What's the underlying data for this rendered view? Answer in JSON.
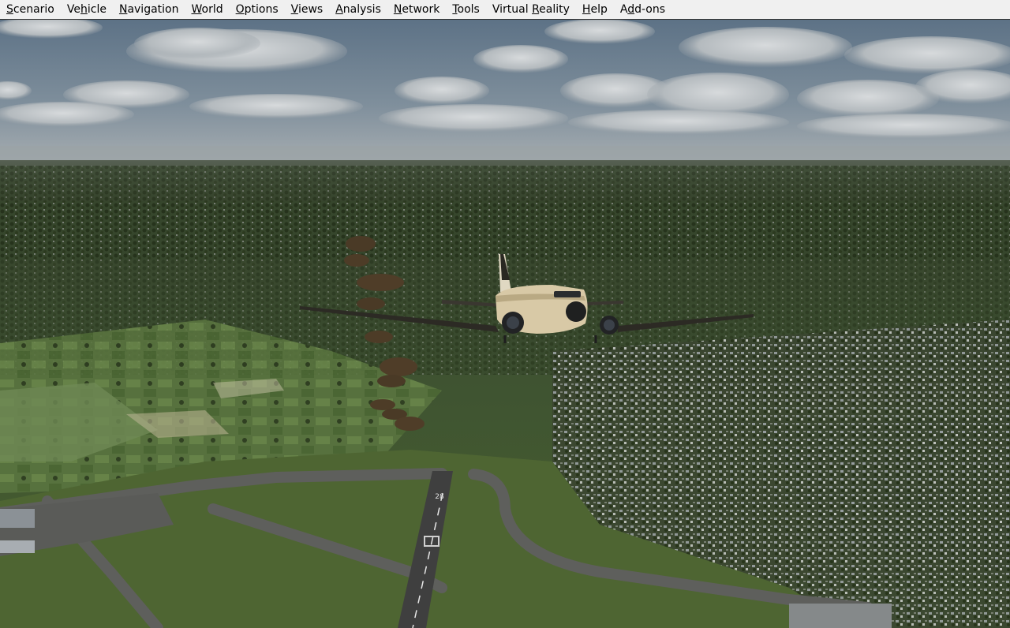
{
  "app": {
    "menu": [
      {
        "pre": "",
        "key": "S",
        "post": "cenario"
      },
      {
        "pre": "Ve",
        "key": "h",
        "post": "icle"
      },
      {
        "pre": "",
        "key": "N",
        "post": "avigation"
      },
      {
        "pre": "",
        "key": "W",
        "post": "orld"
      },
      {
        "pre": "",
        "key": "O",
        "post": "ptions"
      },
      {
        "pre": "",
        "key": "V",
        "post": "iews"
      },
      {
        "pre": "",
        "key": "A",
        "post": "nalysis"
      },
      {
        "pre": "",
        "key": "N",
        "post": "etwork"
      },
      {
        "pre": "",
        "key": "T",
        "post": "ools"
      },
      {
        "pre": "Virtual ",
        "key": "R",
        "post": "eality"
      },
      {
        "pre": "",
        "key": "H",
        "post": "elp"
      },
      {
        "pre": "A",
        "key": "d",
        "post": "d-ons"
      }
    ]
  },
  "scene": {
    "runway_number": "28",
    "colors": {
      "sky_top": "#5d7286",
      "sky_horizon": "#9aa4ab",
      "terrain_far": "#3f4a33",
      "terrain_near": "#4f6a36",
      "runway": "#4a4a4a",
      "aircraft_body": "#d8c9a6"
    }
  }
}
